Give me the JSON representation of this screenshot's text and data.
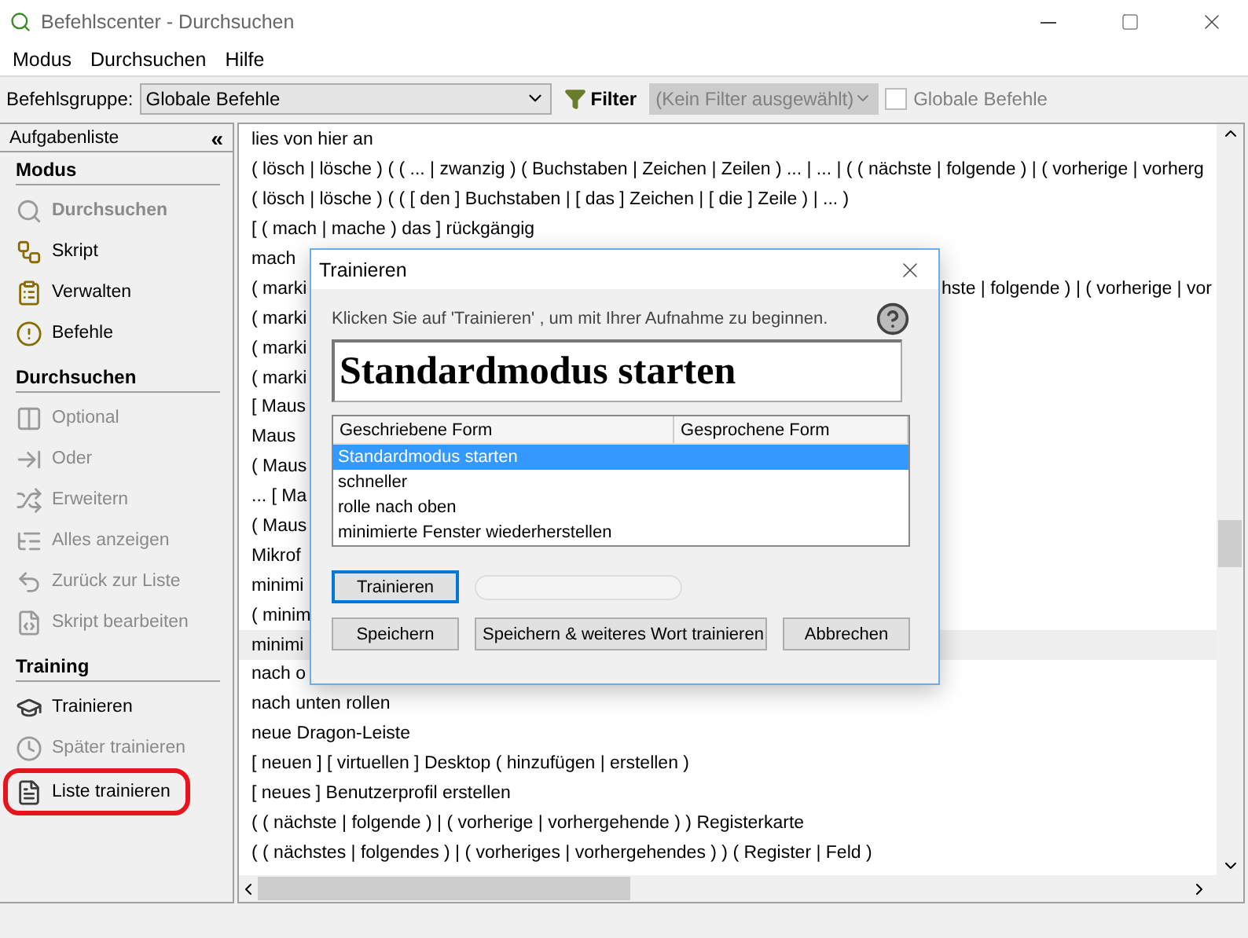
{
  "window": {
    "title": "Befehlscenter - Durchsuchen"
  },
  "menu": [
    "Modus",
    "Durchsuchen",
    "Hilfe"
  ],
  "toolbar": {
    "group_label": "Befehlsgruppe:",
    "group_value": "Globale Befehle",
    "filter_label": "Filter",
    "filter_value": "(Kein Filter ausgewählt)",
    "filter_disabled": true,
    "global_checkbox": {
      "label": "Globale Befehle",
      "checked": false,
      "disabled": true
    }
  },
  "sidebar": {
    "title": "Aufgabenliste",
    "collapse": "«",
    "sections": [
      {
        "title": "Modus",
        "items": [
          {
            "label": "Durchsuchen",
            "selected": true,
            "disabled": true,
            "circled": false
          },
          {
            "label": "Skript",
            "selected": false,
            "disabled": false,
            "circled": false
          },
          {
            "label": "Verwalten",
            "selected": false,
            "disabled": false,
            "circled": false
          },
          {
            "label": "Befehle",
            "selected": false,
            "disabled": false,
            "circled": false
          }
        ]
      },
      {
        "title": "Durchsuchen",
        "items": [
          {
            "label": "Optional",
            "selected": false,
            "disabled": true,
            "circled": false
          },
          {
            "label": "Oder",
            "selected": false,
            "disabled": true,
            "circled": false
          },
          {
            "label": "Erweitern",
            "selected": false,
            "disabled": true,
            "circled": false
          },
          {
            "label": "Alles anzeigen",
            "selected": false,
            "disabled": true,
            "circled": false
          },
          {
            "label": "Zurück zur Liste",
            "selected": false,
            "disabled": true,
            "circled": false
          },
          {
            "label": "Skript bearbeiten",
            "selected": false,
            "disabled": true,
            "circled": false
          }
        ]
      },
      {
        "title": "Training",
        "items": [
          {
            "label": "Trainieren",
            "selected": false,
            "disabled": false,
            "circled": false
          },
          {
            "label": "Später trainieren",
            "selected": false,
            "disabled": true,
            "circled": false
          },
          {
            "label": "Liste trainieren",
            "selected": false,
            "disabled": false,
            "circled": true
          }
        ]
      }
    ]
  },
  "commands": [
    {
      "text": "lies von hier an",
      "selected": false
    },
    {
      "text": "( lösch | lösche ) ( ( ... | zwanzig ) ( Buchstaben | Zeichen | Zeilen ) ... | ... | ( ( nächste | folgende ) | ( vorherige | vorherg",
      "selected": false
    },
    {
      "text": "( lösch | lösche ) ( ( [ den ] Buchstaben | [ das ] Zeichen | [ die ] Zeile ) | ... )",
      "selected": false
    },
    {
      "text": "[ ( mach | mache ) das ] rückgängig",
      "selected": false
    },
    {
      "text": "mach",
      "selected": false
    },
    {
      "text": "( marki",
      "text_after": "hste | folgende ) | ( vorherige | vor",
      "selected": false
    },
    {
      "text": "( marki",
      "selected": false
    },
    {
      "text": "( marki",
      "selected": false
    },
    {
      "text": "( marki",
      "selected": false
    },
    {
      "text": "[ Maus",
      "selected": false
    },
    {
      "text": "Maus",
      "selected": false
    },
    {
      "text": "( Maus",
      "selected": false
    },
    {
      "text": "... [ Ma",
      "selected": false
    },
    {
      "text": "( Maus",
      "selected": false
    },
    {
      "text": "Mikrof",
      "selected": false
    },
    {
      "text": "minimi",
      "selected": false
    },
    {
      "text": "( minim",
      "selected": false
    },
    {
      "text": "minimi",
      "selected": true
    },
    {
      "text": "nach o",
      "selected": false
    },
    {
      "text": "nach unten rollen",
      "selected": false
    },
    {
      "text": "neue Dragon-Leiste",
      "selected": false
    },
    {
      "text": "[ neuen ] [ virtuellen ] Desktop ( hinzufügen | erstellen )",
      "selected": false
    },
    {
      "text": "[ neues ] Benutzerprofil erstellen",
      "selected": false
    },
    {
      "text": "( ( nächste | folgende ) | ( vorherige | vorhergehende ) ) Registerkarte",
      "selected": false
    },
    {
      "text": "( ( nächstes | folgendes ) | ( vorheriges | vorhergehendes ) ) ( Register | Feld )",
      "selected": false
    }
  ],
  "dialog": {
    "title": "Trainieren",
    "instruction": "Klicken Sie auf 'Trainieren' , um mit Ihrer Aufnahme zu beginnen.",
    "phrase": "Standardmodus starten",
    "columns": [
      "Geschriebene Form",
      "Gesprochene Form"
    ],
    "rows": [
      {
        "written": "Standardmodus starten",
        "selected": true
      },
      {
        "written": "schneller",
        "selected": false
      },
      {
        "written": "rolle nach oben",
        "selected": false
      },
      {
        "written": "minimierte Fenster wiederherstellen",
        "selected": false
      }
    ],
    "train_button": {
      "label": "Trainieren",
      "focused": true
    },
    "progress": {
      "level": 0
    },
    "buttons": [
      "Speichern",
      "Speichern & weiteres Wort trainieren",
      "Abbrechen"
    ]
  }
}
